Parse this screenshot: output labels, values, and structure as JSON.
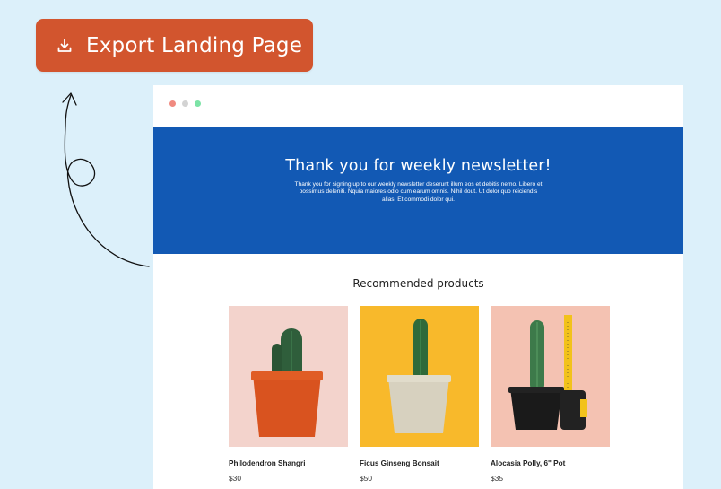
{
  "export_button": {
    "label": "Export Landing Page",
    "icon": "download-icon"
  },
  "window_controls": [
    "#f08a80",
    "#d3d3d3",
    "#7ce3a6"
  ],
  "hero": {
    "title": "Thank you for weekly newsletter!",
    "body": "Thank you for signing up to our weekly newsletter deserunt illum eos et debitis nemo. Libero et possimus deleniti. Nquia maiores odio cum earum omnis. Nihil dout. Ut dolor quo reiciendis alias. Et commodi dolor qui."
  },
  "recommended": {
    "title": "Recommended products",
    "products": [
      {
        "name": "Philodendron Shangri",
        "price": "$30",
        "bg": "#f3d3cc"
      },
      {
        "name": "Ficus Ginseng Bonsait",
        "price": "$50",
        "bg": "#f8b92b"
      },
      {
        "name": "Alocasia Polly, 6\" Pot",
        "price": "$35",
        "bg": "#f4c2b2"
      }
    ]
  },
  "colors": {
    "background": "#dcf0fa",
    "accent": "#d2552e",
    "hero": "#1259b4"
  }
}
